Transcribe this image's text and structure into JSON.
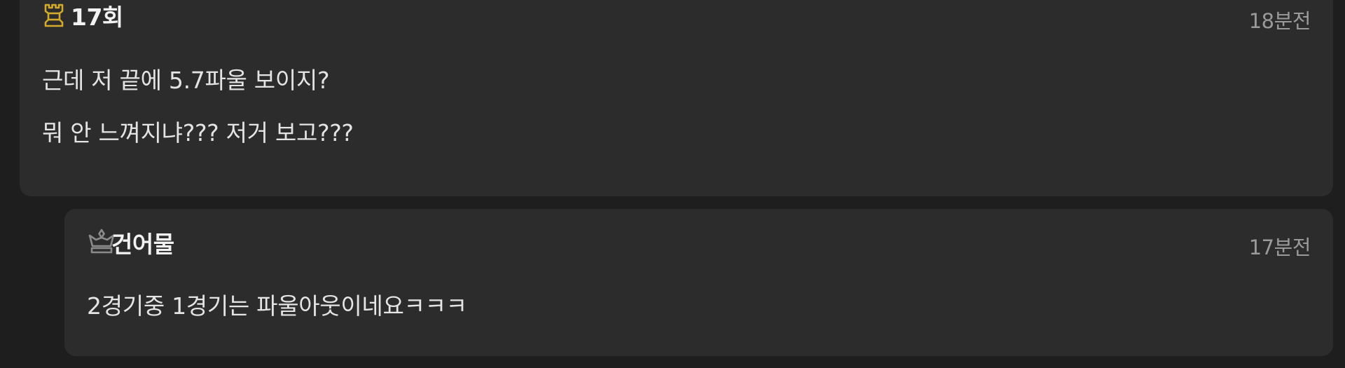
{
  "comments": [
    {
      "nickname": "17회",
      "badge_icon": "gold-rook-icon",
      "badge_color": "#d4aa2a",
      "time": "18분전",
      "lines": [
        "근데 저 끝에 5.7파울 보이지?",
        "뭐 안 느껴지냐??? 저거 보고???"
      ]
    },
    {
      "nickname": "건어물",
      "badge_icon": "gray-crown-icon",
      "badge_color": "#8a8a8a",
      "time": "17분전",
      "lines": [
        "2경기중 1경기는 파울아웃이네요ㅋㅋㅋ"
      ]
    }
  ],
  "colors": {
    "background": "#1e1e1e",
    "card": "#2c2c2c",
    "text": "#e4e4e4",
    "muted": "#9a9a9a"
  }
}
